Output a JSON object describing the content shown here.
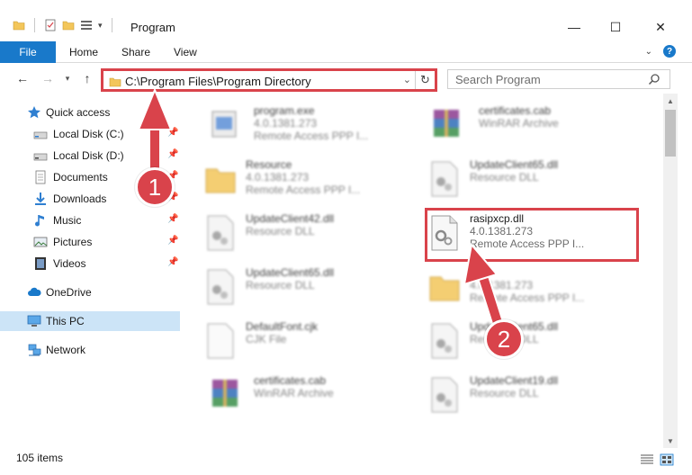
{
  "window": {
    "title": "Program",
    "controls": {
      "minimize": "—",
      "maximize": "☐",
      "close": "✕"
    }
  },
  "ribbon": {
    "tabs": [
      "File",
      "Home",
      "Share",
      "View"
    ],
    "help": "?"
  },
  "address_bar": {
    "path": "C:\\Program Files\\Program Directory"
  },
  "search": {
    "placeholder": "Search Program"
  },
  "sidebar": {
    "items": [
      {
        "label": "Quick access",
        "icon": "star-icon",
        "pinned": false
      },
      {
        "label": "Local Disk (C:)",
        "icon": "drive-icon",
        "pinned": true
      },
      {
        "label": "Local Disk (D:)",
        "icon": "drive-icon",
        "pinned": true
      },
      {
        "label": "Documents",
        "icon": "documents-icon",
        "pinned": true
      },
      {
        "label": "Downloads",
        "icon": "download-icon",
        "pinned": true
      },
      {
        "label": "Music",
        "icon": "music-icon",
        "pinned": true
      },
      {
        "label": "Pictures",
        "icon": "pictures-icon",
        "pinned": true
      },
      {
        "label": "Videos",
        "icon": "video-icon",
        "pinned": true
      },
      {
        "label": "OneDrive",
        "icon": "cloud-icon",
        "pinned": false
      },
      {
        "label": "This PC",
        "icon": "computer-icon",
        "pinned": false,
        "selected": true
      },
      {
        "label": "Network",
        "icon": "network-icon",
        "pinned": false
      }
    ]
  },
  "files": [
    {
      "name": "program.exe",
      "meta1": "4.0.1381.273",
      "meta2": "Remote Access PPP I...",
      "icon": "exe-icon"
    },
    {
      "name": "certificates.cab",
      "meta1": "WinRAR Archive",
      "meta2": "",
      "icon": "winrar-icon"
    },
    {
      "name": "Resource",
      "meta1": "4.0.1381.273",
      "meta2": "Remote Access PPP I...",
      "icon": "folder-icon"
    },
    {
      "name": "UpdateClient65.dll",
      "meta1": "Resource DLL",
      "meta2": "",
      "icon": "dll-icon"
    },
    {
      "name": "UpdateClient42.dll",
      "meta1": "Resource DLL",
      "meta2": "",
      "icon": "dll-icon"
    },
    {
      "name": "rasipxcp.dll",
      "meta1": "4.0.1381.273",
      "meta2": "Remote Access PPP I...",
      "icon": "dll-icon"
    },
    {
      "name": "UpdateClient65.dll",
      "meta1": "Resource DLL",
      "meta2": "",
      "icon": "dll-icon"
    },
    {
      "name": "",
      "meta1": "4.0.1381.273",
      "meta2": "Remote Access PPP I...",
      "icon": "folder-icon"
    },
    {
      "name": "DefaultFont.cjk",
      "meta1": "CJK File",
      "meta2": "",
      "icon": "file-icon"
    },
    {
      "name": "UpdateClient65.dll",
      "meta1": "Resource DLL",
      "meta2": "",
      "icon": "dll-icon"
    },
    {
      "name": "certificates.cab",
      "meta1": "WinRAR Archive",
      "meta2": "",
      "icon": "winrar-icon"
    },
    {
      "name": "UpdateClient19.dll",
      "meta1": "Resource DLL",
      "meta2": "",
      "icon": "dll-icon"
    }
  ],
  "status": {
    "count": "105 items"
  },
  "annotations": {
    "step1": "1",
    "step2": "2",
    "color": "#d9434b"
  },
  "colors": {
    "accent": "#1979ca",
    "selection": "#cce4f7",
    "annotation_red": "#d9434b"
  }
}
